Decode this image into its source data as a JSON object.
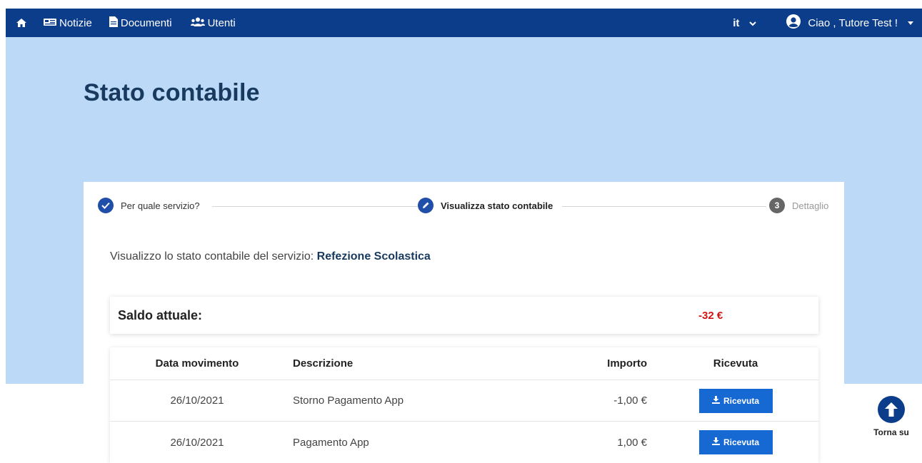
{
  "nav": {
    "home_icon": "home-icon",
    "items": [
      {
        "label": "Notizie",
        "icon": "newspaper-icon"
      },
      {
        "label": "Documenti",
        "icon": "document-icon"
      },
      {
        "label": "Utenti",
        "icon": "users-icon"
      }
    ],
    "language": "it",
    "greeting": "Ciao , Tutore Test !"
  },
  "page": {
    "title": "Stato contabile"
  },
  "stepper": {
    "steps": [
      {
        "label": "Per quale servizio?",
        "state": "done"
      },
      {
        "label": "Visualizza stato contabile",
        "state": "active"
      },
      {
        "label": "Dettaglio",
        "state": "pending",
        "number": "3"
      }
    ]
  },
  "intro": {
    "text": "Visualizzo lo stato contabile del servizio:",
    "service": "Refezione Scolastica"
  },
  "balance": {
    "label": "Saldo attuale:",
    "value": "-32 €"
  },
  "table": {
    "headers": [
      "Data movimento",
      "Descrizione",
      "Importo",
      "Ricevuta"
    ],
    "rows": [
      {
        "date": "26/10/2021",
        "description": "Storno Pagamento App",
        "amount": "-1,00 €",
        "button": "Ricevuta"
      },
      {
        "date": "26/10/2021",
        "description": "Pagamento App",
        "amount": "1,00 €",
        "button": "Ricevuta"
      }
    ]
  },
  "back_to_top": {
    "label": "Torna su"
  },
  "colors": {
    "navbar": "#0c3d8a",
    "hero": "#bcd9f7",
    "button": "#1668d3",
    "negative": "#d01515"
  }
}
